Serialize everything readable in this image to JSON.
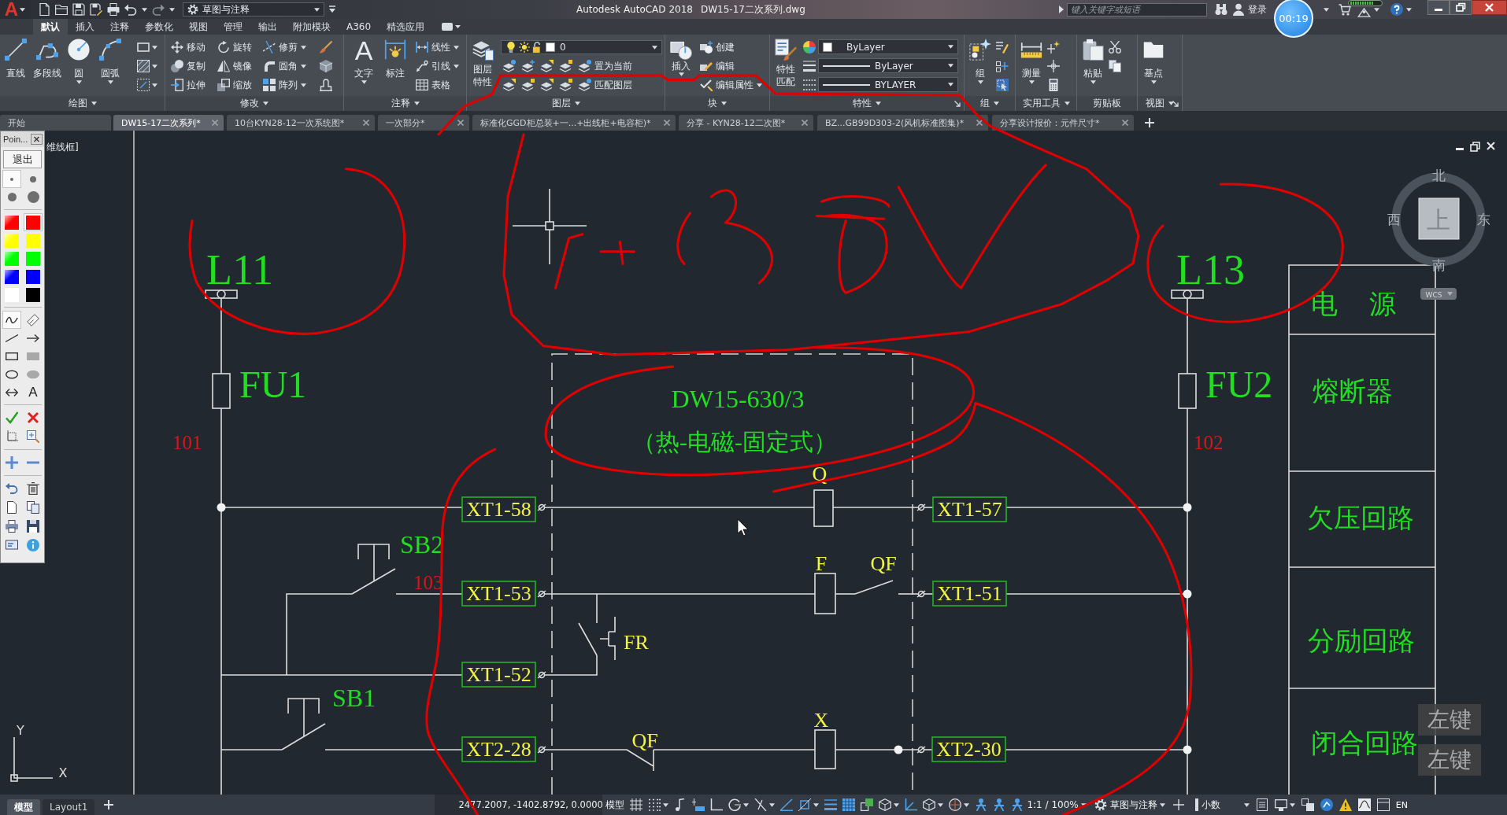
{
  "title_bar": {
    "logo": "A",
    "workspace": "草图与注释",
    "app_title": "Autodesk AutoCAD 2018",
    "file_name": "DW15-17二次系列.dwg",
    "search": {
      "placeholder": "键入关键字或短语"
    },
    "sign_in": "登录"
  },
  "recorder": {
    "timer": "00:19",
    "keys": [
      "左键",
      "左键"
    ]
  },
  "ribbon_tabs": [
    {
      "label": "默认",
      "selected": true
    },
    {
      "label": "插入",
      "selected": false
    },
    {
      "label": "注释",
      "selected": false
    },
    {
      "label": "参数化",
      "selected": false
    },
    {
      "label": "视图",
      "selected": false
    },
    {
      "label": "管理",
      "selected": false
    },
    {
      "label": "输出",
      "selected": false
    },
    {
      "label": "附加模块",
      "selected": false
    },
    {
      "label": "A360",
      "selected": false
    },
    {
      "label": "精选应用",
      "selected": false
    }
  ],
  "ribbon_panels": [
    {
      "title": "绘图",
      "tools": [
        "直线",
        "多段线",
        "圆",
        "圆弧"
      ]
    },
    {
      "title": "修改",
      "tools": [
        "移动",
        "旋转",
        "修剪",
        "复制",
        "镜像",
        "圆角",
        "拉伸",
        "缩放",
        "阵列"
      ]
    },
    {
      "title": "注释",
      "glyph": "A",
      "tools": [
        "文字",
        "标注"
      ],
      "small_tools": [
        "线性",
        "引线",
        "表格"
      ]
    },
    {
      "title": "图层",
      "tools": [
        "图层特性"
      ],
      "layer": "0",
      "small_tools": [
        "置为当前",
        "匹配图层"
      ]
    },
    {
      "title": "块",
      "tools": [
        "插入"
      ],
      "small_tools": [
        "创建",
        "编辑",
        "编辑属性"
      ]
    },
    {
      "title": "特性",
      "tools": [
        "特性匹配"
      ],
      "dropdowns": [
        "ByLayer",
        "ByLayer",
        "BYLAYER"
      ]
    },
    {
      "title": "组",
      "tools": [
        "组"
      ]
    },
    {
      "title": "实用工具",
      "tools": [
        "测量"
      ]
    },
    {
      "title": "剪贴板",
      "tools": [
        "粘贴"
      ]
    },
    {
      "title": "视图",
      "tools": [
        "基点"
      ]
    }
  ],
  "document_tabs": [
    {
      "label": "开始",
      "selected": false
    },
    {
      "label": "DW15-17二次系列*",
      "selected": true
    },
    {
      "label": "10台KYN28-12一次系统图*",
      "selected": false
    },
    {
      "label": "一次部分*",
      "selected": false
    },
    {
      "label": "标准化GGD柜总装+一...+出线柜+电容柜)*",
      "selected": false
    },
    {
      "label": "分享 - KYN28-12二次图*",
      "selected": false
    },
    {
      "label": "BZ...GB99D303-2(风机标准图集)*",
      "selected": false
    },
    {
      "label": "分享设计报价：元件尺寸*",
      "selected": false
    }
  ],
  "pointer_palette": {
    "title": "Poin...",
    "exit": "退出",
    "sizes": [
      {
        "selected": true
      },
      {
        "selected": false
      },
      {
        "selected": false
      },
      {
        "selected": false
      }
    ],
    "colors": [
      {
        "kind": "marker",
        "color": "#ff0000",
        "selected": false
      },
      {
        "kind": "pen",
        "color": "#ff0000",
        "selected": true
      },
      {
        "kind": "marker",
        "color": "#ffff00",
        "selected": false
      },
      {
        "kind": "pen",
        "color": "#ffff00",
        "selected": false
      },
      {
        "kind": "marker",
        "color": "#00ff00",
        "selected": false
      },
      {
        "kind": "pen",
        "color": "#00ff00",
        "selected": false
      },
      {
        "kind": "marker",
        "color": "#0000ff",
        "selected": false
      },
      {
        "kind": "pen",
        "color": "#0000ff",
        "selected": false
      },
      {
        "kind": "pen",
        "color": "#ffffff",
        "selected": false
      },
      {
        "kind": "pen",
        "color": "#000000",
        "selected": false
      }
    ],
    "tools": [
      {
        "selected": true
      },
      {
        "selected": false
      },
      {
        "selected": false
      },
      {
        "selected": false
      },
      {
        "selected": false
      },
      {
        "selected": false
      },
      {
        "selected": false
      },
      {
        "selected": false
      },
      {
        "selected": false
      },
      {
        "label": "A",
        "selected": false
      }
    ]
  },
  "drawing": {
    "viewport_label": "维线框]",
    "supplies": [
      {
        "label": "L11",
        "fuse": "FU1",
        "wire_number": "101"
      },
      {
        "label": "L13",
        "fuse": "FU2",
        "wire_number": "102"
      }
    ],
    "breaker": {
      "model": "DW15-630/3",
      "release": "（热-电磁-固定式）"
    },
    "terminals": [
      "XT1-58",
      "XT1-57",
      "XT1-53",
      "XT1-51",
      "XT1-52",
      "XT2-28",
      "XT2-30"
    ],
    "device_labels": [
      "Q",
      "SB2",
      "F",
      "QF",
      "FR",
      "SB1",
      "QF",
      "X"
    ],
    "wire_numbers": [
      "103"
    ],
    "legend": [
      "电 源",
      "熔断器",
      "欠压回路",
      "分励回路",
      "闭合回路"
    ]
  },
  "view_cube": {
    "north": "北",
    "west": "西",
    "east": "东",
    "south": "南",
    "face": "上",
    "ucs_menu": "WCS"
  },
  "ucs_axes": {
    "y": "Y",
    "x": "X"
  },
  "status_bar": {
    "layout_tabs": [
      {
        "label": "模型",
        "selected": true
      },
      {
        "label": "Layout1",
        "selected": false
      }
    ],
    "coordinates": "2477.2007, -1402.8792, 0.0000",
    "space": "模型",
    "scale": "1:1 / 100%",
    "workspace": "草图与注释",
    "units": "小数",
    "language": "EN"
  }
}
